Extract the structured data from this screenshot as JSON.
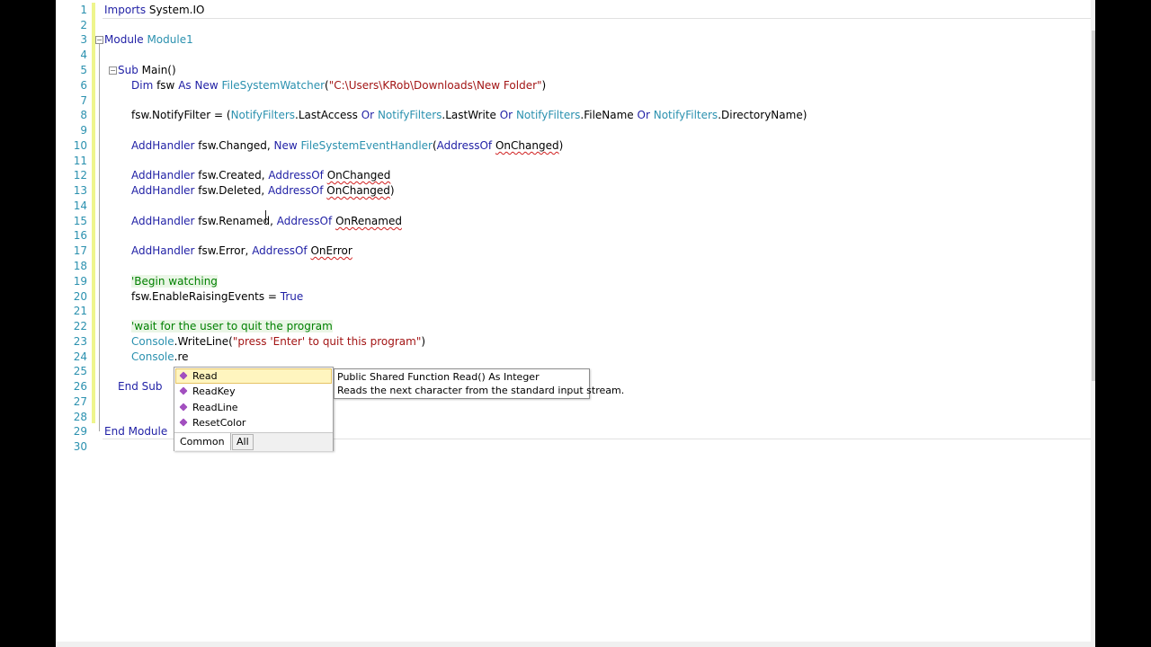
{
  "editor": {
    "line_numbers": [
      "1",
      "2",
      "3",
      "4",
      "5",
      "6",
      "7",
      "8",
      "9",
      "10",
      "11",
      "12",
      "13",
      "14",
      "15",
      "16",
      "17",
      "18",
      "19",
      "20",
      "21",
      "22",
      "23",
      "24",
      "25",
      "26",
      "27",
      "28",
      "29",
      "30"
    ],
    "fold_glyph": "−",
    "code": {
      "l1": {
        "kw": "Imports",
        "rest": " System.IO"
      },
      "l3": {
        "kw": "Module",
        "name": " Module1"
      },
      "l5": {
        "kw": "Sub",
        "rest": " Main()"
      },
      "l6": {
        "kw1": "Dim",
        "a": " fsw ",
        "kw2": "As",
        "b": " ",
        "kw3": "New",
        "c": " ",
        "type": "FileSystemWatcher",
        "d": "(",
        "str": "\"C:\\Users\\KRob\\Downloads\\New Folder\"",
        "e": ")"
      },
      "l8": {
        "a": "fsw.NotifyFilter = (",
        "t1": "NotifyFilters",
        "b": ".LastAccess ",
        "o1": "Or",
        "c": " ",
        "t2": "NotifyFilters",
        "d": ".LastWrite ",
        "o2": "Or",
        "e": " ",
        "t3": "NotifyFilters",
        "f": ".FileName ",
        "o3": "Or",
        "g": " ",
        "t4": "NotifyFilters",
        "h": ".DirectoryName)"
      },
      "l10": {
        "kw1": "AddHandler",
        "a": " fsw.Changed, ",
        "kw2": "New",
        "b": " ",
        "type": "FileSystemEventHandler",
        "c": "(",
        "kw3": "AddressOf",
        "d": " ",
        "sq": "OnChanged",
        "e": ")"
      },
      "l12": {
        "kw1": "AddHandler",
        "a": " fsw.Created, ",
        "kw2": "AddressOf",
        "b": " ",
        "sq": "OnChanged"
      },
      "l13": {
        "kw1": "AddHandler",
        "a": " fsw.Deleted, ",
        "kw2": "AddressOf",
        "b": " ",
        "sq": "OnChanged",
        "c": ")"
      },
      "l15": {
        "kw1": "AddHandler",
        "a": " fsw.Renamed, ",
        "kw2": "AddressOf",
        "b": " ",
        "sq": "OnRenamed"
      },
      "l17": {
        "kw1": "AddHandler",
        "a": " fsw.Error, ",
        "kw2": "AddressOf",
        "b": " ",
        "sq": "OnError"
      },
      "l19": {
        "comment": "'Begin watching"
      },
      "l20": {
        "a": "fsw.EnableRaisingEvents = ",
        "kw": "True"
      },
      "l22": {
        "comment": "'wait for the user to quit the program"
      },
      "l23": {
        "type": "Console",
        "a": ".WriteLine(",
        "str": "\"press 'Enter' to quit this program\"",
        "b": ")"
      },
      "l24": {
        "type": "Console",
        "a": ".re"
      },
      "l26": {
        "kw": "End Sub"
      },
      "l29": {
        "kw": "End Module"
      }
    }
  },
  "completion": {
    "items": [
      "Read",
      "ReadKey",
      "ReadLine",
      "ResetColor"
    ],
    "selected_index": 0,
    "item_icon": "method-icon",
    "tabs": [
      "Common",
      "All"
    ]
  },
  "tooltip": {
    "signature": "Public Shared Function Read() As Integer",
    "description": "Reads the next character from the standard input stream."
  },
  "colors": {
    "keyword": "#1f1fa5",
    "type": "#2b91af",
    "string": "#a31515",
    "comment": "#008000",
    "line_number": "#2b91af",
    "changed_bar": "#eef58c"
  }
}
